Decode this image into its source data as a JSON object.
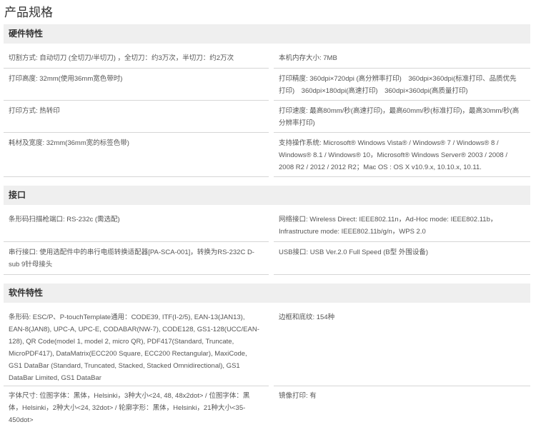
{
  "page_title": "产品规格",
  "sections": {
    "hardware": {
      "title": "硬件特性",
      "rows": [
        [
          "切割方式: 自动切刀 (全切刀/半切刀) ，全切刀：约3万次，半切刀：约2万次",
          "本机内存大小: 7MB"
        ],
        [
          "打印高度: 32mm(使用36mm宽色带时)",
          "打印精度: 360dpi×720dpi (高分辨率打印)　360dpi×360dpi(标准打印、品质优先打印)　360dpi×180dpi(高速打印)　360dpi×360dpi(高质量打印)"
        ],
        [
          "打印方式: 热转印",
          "打印速度: 最高80mm/秒(高速打印)，最高60mm/秒(标准打印)，最高30mm/秒(高分辨率打印)"
        ],
        [
          "耗材及宽度: 32mm(36mm宽的标签色带)",
          "支持操作系统: Microsoft® Windows Vista® / Windows® 7 / Windows® 8 / Windows® 8.1 / Windows® 10，Microsoft® Windows Server® 2003 / 2008 / 2008 R2 / 2012 / 2012 R2；Mac OS : OS X v10.9.x, 10.10.x, 10.11."
        ]
      ]
    },
    "interface": {
      "title": "接口",
      "rows": [
        [
          "条形码扫描枪端口: RS-232c (需选配)",
          "网络接口: Wireless Direct: IEEE802.11n，Ad-Hoc mode: IEEE802.11b，Infrastructure mode: IEEE802.11b/g/n，WPS 2.0"
        ],
        [
          "串行接口: 使用选配件中的串行电缆转换适配器[PA-SCA-001]，转换为RS-232C D-sub 9针母接头",
          "USB接口: USB Ver.2.0 Full Speed (B型 外围设备)"
        ]
      ]
    },
    "software": {
      "title": "软件特性",
      "rows": [
        [
          "条形码: ESC/P、P-touchTemplate通用：CODE39, ITF(I-2/5), EAN-13(JAN13), EAN-8(JAN8), UPC-A, UPC-E, CODABAR(NW-7), CODE128, GS1-128(UCC/EAN-128), QR Code(model 1, model 2, micro QR), PDF417(Standard, Truncate, MicroPDF417), DataMatrix(ECC200 Square, ECC200 Rectangular), MaxiCode, GS1 DataBar (Standard, Truncated, Stacked, Stacked Omnidirectional), GS1 DataBar Limited, GS1 DataBar",
          "边框和底纹: 154种"
        ],
        [
          "字体尺寸: 位图字体：黑体，Helsinki，3种大小<24, 48, 48x2dot> / 位图字体：黑体，Helsinki，2种大小<24, 32dot> / 轮廓字形：黑体，Helsinki，21种大小<35-450dot>",
          "镜像打印: 有"
        ]
      ]
    }
  }
}
